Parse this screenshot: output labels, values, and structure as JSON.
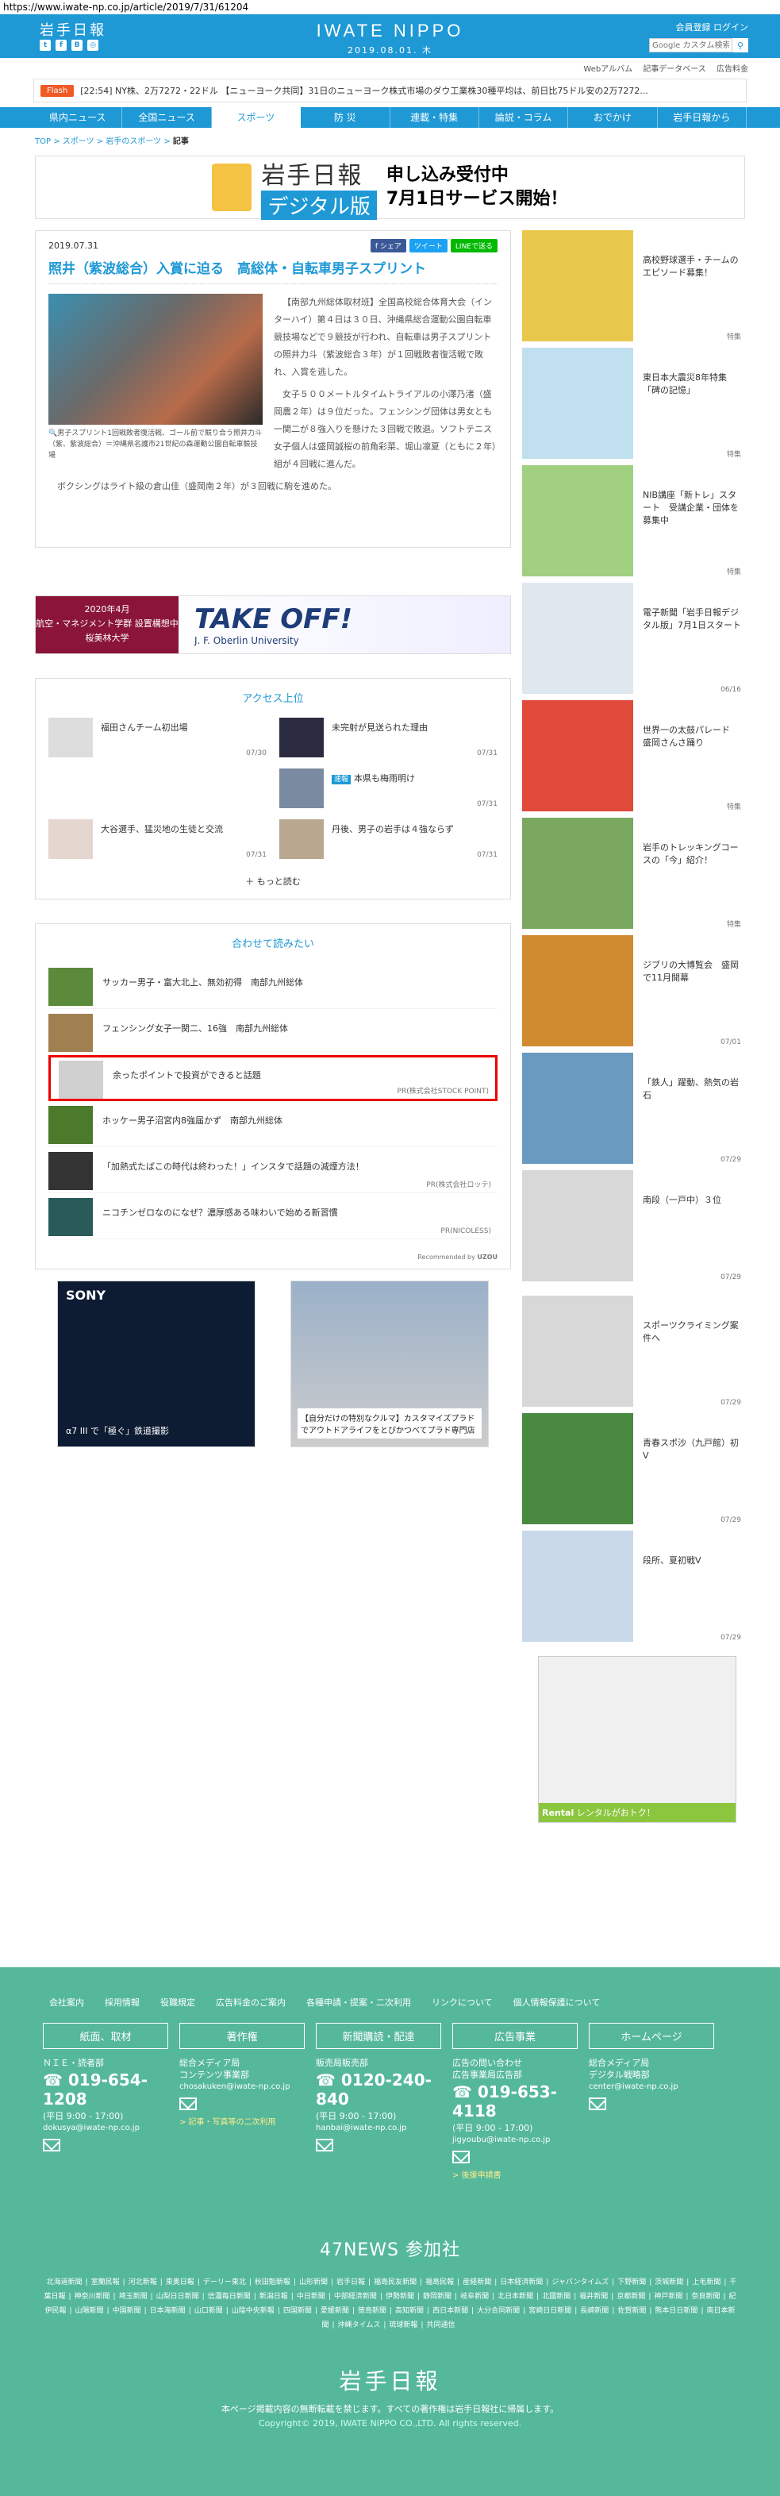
{
  "url": "https://www.iwate-np.co.jp/article/2019/7/31/61204",
  "header": {
    "logo_left": "岩手日報",
    "center_logo": "IWATE NIPPO",
    "date": "2019.08.01. 木",
    "login": "会員登録  ログイン",
    "search_placeholder": "Google カスタム検索",
    "social": [
      "t",
      "f",
      "B",
      "◎"
    ]
  },
  "subnav": [
    "Webアルバム",
    "記事データベース",
    "広告料金"
  ],
  "flash": {
    "badge": "Flash",
    "text": "[22:54] NY株、2万7272・22ドル  【ニューヨーク共同】31日のニューヨーク株式市場のダウ工業株30種平均は、前日比75ドル安の2万7272..."
  },
  "nav": [
    "県内ニュース",
    "全国ニュース",
    "スポーツ",
    "防 災",
    "連載・特集",
    "論説・コラム",
    "おでかけ",
    "岩手日報から"
  ],
  "breadcrumb": [
    "TOP",
    "スポーツ",
    "岩手のスポーツ",
    "記事"
  ],
  "banner": {
    "logo": "岩手日報",
    "digital": "デジタル版",
    "line1": "申し込み受付中",
    "line2": "7月1日サービス開始！"
  },
  "article": {
    "date": "2019.07.31",
    "share": [
      "f シェア",
      "ツイート",
      "LINEで送る"
    ],
    "title": "照井（紫波総合）入賞に迫る　高総体・自転車男子スプリント",
    "caption": "男子スプリント1回戦敗者復活戦、ゴール前で競り合う照井力斗（紫、紫波総合）＝沖縄県名護市21世紀の森運動公園自転車競技場",
    "body": [
      "【南部九州総体取材班】全国高校総合体育大会（インターハイ）第４日は３０日、沖縄県総合運動公園自転車競技場などで９競技が行われ、自転車は男子スプリントの照井力斗（紫波総合３年）が１回戦敗者復活戦で敗れ、入賞を逃した。",
      "女子５００メートルタイムトライアルの小澤乃渚（盛岡農２年）は９位だった。フェンシング団体は男女とも一関二が８強入りを懸けた３回戦で敗退。ソフトテニス女子個人は盛岡誠桜の前角彩菜、堀山凛夏（ともに２年）組が４回戦に進んだ。",
      "ボクシングはライト級の倉山佳（盛岡南２年）が３回戦に駒を進めた。"
    ]
  },
  "ad_wide": {
    "l1": "2020年4月",
    "l2": "航空・マネジメント学群 設置構想中",
    "l3": "桜美林大学",
    "big": "TAKE OFF!",
    "small": "J. F. Oberlin University"
  },
  "ranking": {
    "title": "アクセス上位",
    "more": "もっと読む",
    "items": [
      {
        "title": "福田さんチーム初出場",
        "date": "07/30"
      },
      {
        "title": "未完射が見送られた理由",
        "date": "07/31"
      },
      {
        "badge": "速報",
        "title": "本県も梅雨明け",
        "date": "07/31"
      },
      {
        "title": "大谷選手、猛災地の生徒と交流",
        "date": "07/31"
      },
      {
        "title": "丹後、男子の岩手は４強ならず",
        "date": "07/31"
      }
    ]
  },
  "related": {
    "title": "合わせて読みたい",
    "recommended": "Recommended by",
    "items": [
      {
        "title": "サッカー男子・富大北上、無効初得　南部九州総体",
        "pr": ""
      },
      {
        "title": "フェンシング女子一関二、16強　南部九州総体",
        "pr": ""
      },
      {
        "title": "余ったポイントで投資ができると話題",
        "pr": "PR(株式会社STOCK POINT)"
      },
      {
        "title": "ホッケー男子沼宮内8強届かず　南部九州総体",
        "pr": ""
      },
      {
        "title": "「加熱式たばこの時代は終わった！」インスタで話題の減煙方法！",
        "pr": "PR(株式会社ロッテ)"
      },
      {
        "title": "ニコチンゼロなのになぜ？濃厚感ある味わいで始める新習慣",
        "pr": "PR(NICOLESS)"
      }
    ]
  },
  "ads2": {
    "sony_brand": "SONY",
    "sony_text": "α7 III で「極ぐ」鉄道撮影",
    "car_text": "【自分だけの特別なクルマ】カスタマイズプラドでアウトドアライフをとびかつべてプラド専門店"
  },
  "sidebar": [
    {
      "title": "高校野球選手・チームのエピソード募集！",
      "date": "特集"
    },
    {
      "title": "東日本大震災8年特集「碑の記憶」",
      "date": "特集"
    },
    {
      "title": "NIB講座「新トレ」スタート　受講企業・団体を募集中",
      "date": "特集"
    },
    {
      "title": "電子新聞「岩手日報デジタル版」7月1日スタート",
      "date": "06/16"
    },
    {
      "title": "世界一の太鼓パレード　盛岡さんさ踊り",
      "date": "特集"
    },
    {
      "title": "岩手のトレッキングコースの「今」紹介！",
      "date": "特集"
    },
    {
      "title": "ジブリの大博覧会　盛岡で11月開幕",
      "date": "07/01"
    },
    {
      "title": "「鉄人」躍動、熱気の岩石",
      "date": "07/29"
    },
    {
      "title": "南段（一戸中）３位",
      "date": "07/29"
    },
    {
      "title": "スポーツクライミング案件へ",
      "date": "07/29"
    },
    {
      "title": "青春スポ沙（九戸館）初V",
      "date": "07/29"
    },
    {
      "title": "段所、夏初戦V",
      "date": "07/29"
    }
  ],
  "side_ad": {
    "text": "レンタルがおトク！",
    "brand": "Rental"
  },
  "footer": {
    "links": [
      "会社案内",
      "採用情報",
      "役職規定",
      "広告料金のご案内",
      "各種申請・提案・二次利用",
      "リンクについて",
      "個人情報保護について"
    ],
    "cols": [
      {
        "head": "紙面、取材",
        "lines": [
          "ＮＩＥ・読者部"
        ],
        "tel": "019-654-1208",
        "hours": "(平日 9:00 - 17:00)",
        "mail": "dokusya@iwate-np.co.jp",
        "link": ""
      },
      {
        "head": "著作権",
        "lines": [
          "総合メディア局",
          "コンテンツ事業部"
        ],
        "tel": "",
        "hours": "",
        "mail": "chosakuken@iwate-np.co.jp",
        "link": "> 記事・写真等の二次利用"
      },
      {
        "head": "新聞購読・配達",
        "lines": [
          "販売局販売部"
        ],
        "tel": "0120-240-840",
        "hours": "(平日 9:00 - 17:00)",
        "mail": "hanbai@iwate-np.co.jp",
        "link": ""
      },
      {
        "head": "広告事業",
        "lines": [
          "広告の問い合わせ",
          "広告事業局広告部"
        ],
        "tel": "019-653-4118",
        "hours": "(平日 9:00 - 17:00)",
        "mail": "jigyoubu@iwate-np.co.jp",
        "link": "> 後援申請書"
      },
      {
        "head": "ホームページ",
        "lines": [
          "総合メディア局",
          "デジタル戦略部"
        ],
        "tel": "",
        "hours": "",
        "mail": "center@iwate-np.co.jp",
        "link": ""
      }
    ],
    "news47": "47NEWS 参加社",
    "papers": [
      "北海道新聞",
      "室蘭民報",
      "河北新報",
      "東奥日報",
      "デーリー東北",
      "秋田魁新報",
      "山形新聞",
      "岩手日報",
      "福島民友新聞",
      "福島民報",
      "産経新聞",
      "日本経済新聞",
      "ジャパンタイムズ",
      "下野新聞",
      "茨城新聞",
      "上毛新聞",
      "千葉日報",
      "神奈川新聞",
      "埼玉新聞",
      "山梨日日新聞",
      "信濃毎日新聞",
      "新潟日報",
      "中日新聞",
      "中部経済新聞",
      "伊勢新聞",
      "静岡新聞",
      "岐阜新聞",
      "北日本新聞",
      "北國新聞",
      "福井新聞",
      "京都新聞",
      "神戸新聞",
      "奈良新聞",
      "紀伊民報",
      "山陽新聞",
      "中国新聞",
      "日本海新聞",
      "山口新聞",
      "山陰中央新報",
      "四国新聞",
      "愛媛新聞",
      "徳島新聞",
      "高知新聞",
      "西日本新聞",
      "大分合同新聞",
      "宮崎日日新聞",
      "長崎新聞",
      "佐賀新聞",
      "熊本日日新聞",
      "南日本新聞",
      "沖縄タイムス",
      "琉球新報",
      "共同通信"
    ],
    "logo": "岩手日報",
    "copy1": "本ページ掲載内容の無断転載を禁じます。すべての著作権は岩手日報社に帰属します。",
    "copy2": "Copyright© 2019, IWATE NIPPO CO.,LTD. All rights reserved."
  }
}
